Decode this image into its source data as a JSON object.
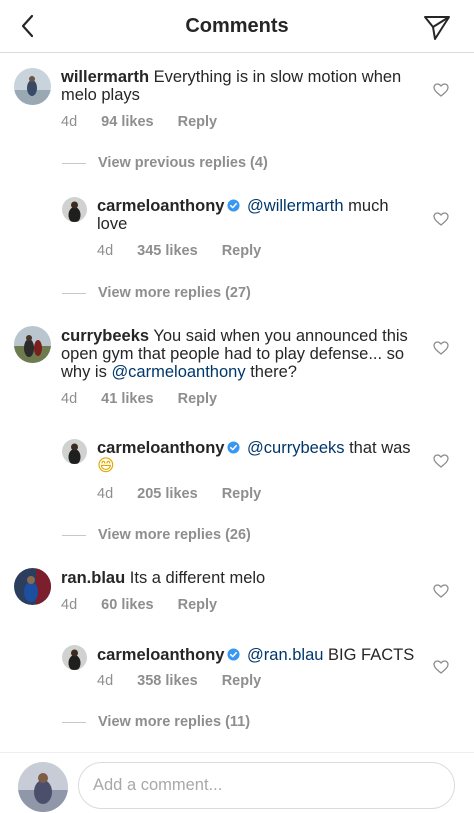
{
  "header": {
    "title": "Comments"
  },
  "comments": [
    {
      "username": "willermarth",
      "text": "Everything is in slow motion when melo plays",
      "time": "4d",
      "likes": "94 likes",
      "reply_label": "Reply",
      "view_replies": "View previous replies (4)",
      "reply": {
        "username": "carmeloanthony",
        "mention": "@willermarth",
        "text": "much love",
        "time": "4d",
        "likes": "345 likes",
        "reply_label": "Reply"
      },
      "view_more": "View more replies (27)"
    },
    {
      "username": "currybeeks",
      "text": "You said when you announced this open gym that people had to play defense... so why is",
      "mention": "@carmeloanthony",
      "text_after": "there?",
      "time": "4d",
      "likes": "41 likes",
      "reply_label": "Reply",
      "reply": {
        "username": "carmeloanthony",
        "mention": "@currybeeks",
        "text": "that was",
        "emoji": "😄",
        "time": "4d",
        "likes": "205 likes",
        "reply_label": "Reply"
      },
      "view_more": "View more replies (26)"
    },
    {
      "username": "ran.blau",
      "text": "Its a different melo",
      "time": "4d",
      "likes": "60 likes",
      "reply_label": "Reply",
      "reply": {
        "username": "carmeloanthony",
        "mention": "@ran.blau",
        "text": "BIG FACTS",
        "time": "4d",
        "likes": "358 likes",
        "reply_label": "Reply"
      },
      "view_more": "View more replies (11)"
    }
  ],
  "footer": {
    "placeholder": "Add a comment..."
  },
  "colors": {
    "verified": "#3897f0",
    "mention": "#00376b",
    "muted": "#8e8e8e"
  }
}
